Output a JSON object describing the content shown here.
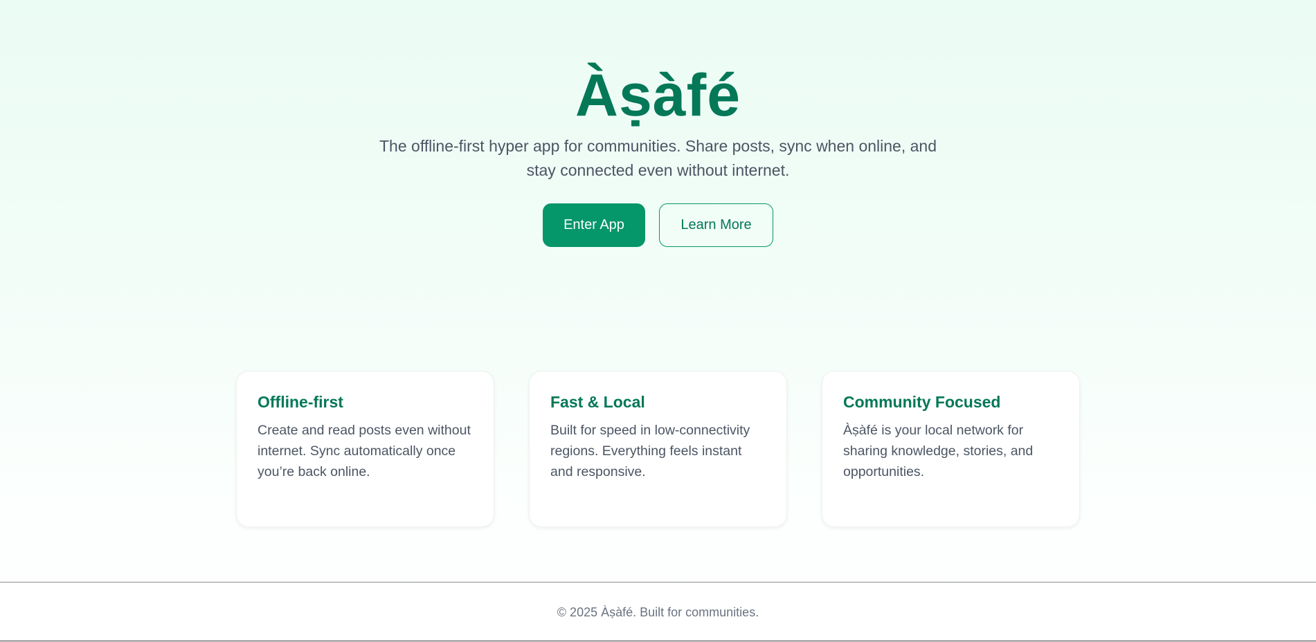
{
  "hero": {
    "title": "Àṣàfé",
    "tagline": "The offline-first hyper app for communities. Share posts, sync when online, and stay connected even without internet.",
    "primary_button": "Enter App",
    "secondary_button": "Learn More"
  },
  "features": [
    {
      "title": "Offline-first",
      "text": "Create and read posts even without internet. Sync automatically once you’re back online."
    },
    {
      "title": "Fast & Local",
      "text": "Built for speed in low-connectivity regions. Everything feels instant and responsive."
    },
    {
      "title": "Community Focused",
      "text": "Àṣàfé is your local network for sharing knowledge, stories, and opportunities."
    }
  ],
  "footer": {
    "text": "© 2025 Àṣàfé. Built for communities."
  },
  "colors": {
    "brand": "#047857",
    "primary_button": "#059669",
    "text": "#4b5563",
    "background_top": "#ebfcf4"
  }
}
